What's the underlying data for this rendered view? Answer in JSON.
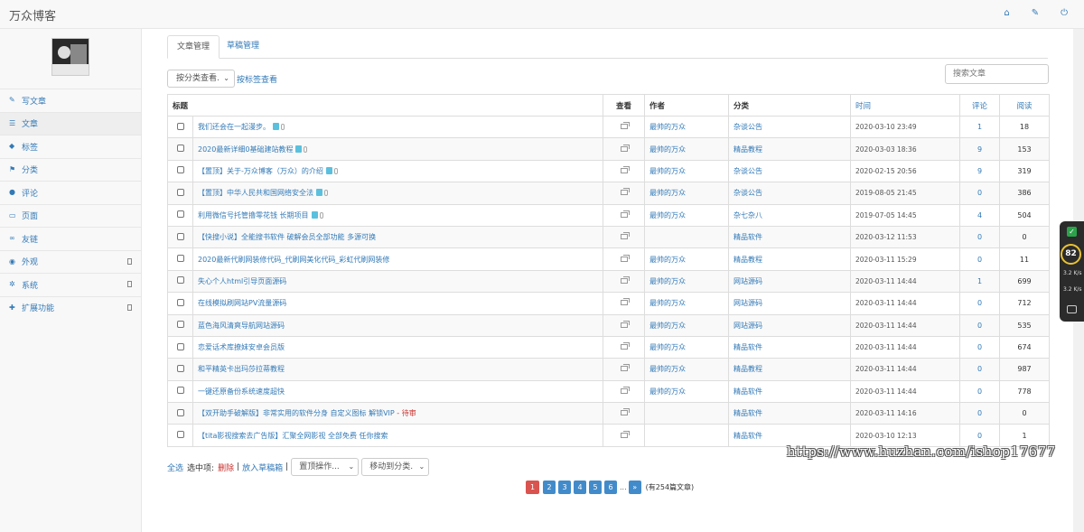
{
  "app": {
    "title": "万众博客"
  },
  "top_icons": [
    "home-icon",
    "wrench-icon",
    "power-icon"
  ],
  "sidebar": {
    "items": [
      {
        "label": "写文章",
        "icon": "pencil-icon",
        "active": false,
        "sub": false
      },
      {
        "label": "文章",
        "icon": "list-icon",
        "active": true,
        "sub": false
      },
      {
        "label": "标签",
        "icon": "tag-icon",
        "active": false,
        "sub": false
      },
      {
        "label": "分类",
        "icon": "flag-icon",
        "active": false,
        "sub": false
      },
      {
        "label": "评论",
        "icon": "comments-icon",
        "active": false,
        "sub": false
      },
      {
        "label": "页面",
        "icon": "file-icon",
        "active": false,
        "sub": false
      },
      {
        "label": "友链",
        "icon": "link-icon",
        "active": false,
        "sub": false
      },
      {
        "label": "外观",
        "icon": "eye-icon",
        "active": false,
        "sub": true
      },
      {
        "label": "系统",
        "icon": "gear-icon",
        "active": false,
        "sub": true
      },
      {
        "label": "扩展功能",
        "icon": "puzzle-icon",
        "active": false,
        "sub": true
      }
    ]
  },
  "tabs": [
    {
      "label": "文章管理",
      "active": true
    },
    {
      "label": "草稿管理",
      "active": false
    }
  ],
  "filters": {
    "category_select": "按分类查看.",
    "tag_link": "按标签查看",
    "search_placeholder": "搜索文章"
  },
  "table": {
    "headers": {
      "title": "标题",
      "view": "查看",
      "author": "作者",
      "category": "分类",
      "time": "时间",
      "comments": "评论",
      "reads": "阅读"
    },
    "rows": [
      {
        "title": "我们还会在一起漫步。",
        "pinned": true,
        "pending": "",
        "author": "最帅的万众",
        "category": "杂谈公告",
        "time": "2020-03-10 23:49",
        "comments": "1",
        "reads": "18"
      },
      {
        "title": "2020最新详细0基础建站教程",
        "pinned": true,
        "pending": "",
        "author": "最帅的万众",
        "category": "精品教程",
        "time": "2020-03-03 18:36",
        "comments": "9",
        "reads": "153"
      },
      {
        "title": "【置顶】关于-万众博客（万众）的介绍",
        "pinned": true,
        "pending": "",
        "author": "最帅的万众",
        "category": "杂谈公告",
        "time": "2020-02-15 20:56",
        "comments": "9",
        "reads": "319"
      },
      {
        "title": "【置顶】中华人民共和国网络安全法",
        "pinned": true,
        "pending": "",
        "author": "最帅的万众",
        "category": "杂谈公告",
        "time": "2019-08-05 21:45",
        "comments": "0",
        "reads": "386"
      },
      {
        "title": "利用微信号托管撸零花钱 长期项目",
        "pinned": true,
        "pending": "",
        "author": "最帅的万众",
        "category": "杂七杂八",
        "time": "2019-07-05 14:45",
        "comments": "4",
        "reads": "504"
      },
      {
        "title": "【快搜小说】全能搜书软件 破解会员全部功能 多源可换",
        "pinned": false,
        "pending": "",
        "author": "",
        "category": "精品软件",
        "time": "2020-03-12 11:53",
        "comments": "0",
        "reads": "0"
      },
      {
        "title": "2020最新代刷网装修代码_代刷网美化代码_彩虹代刷网装修",
        "pinned": false,
        "pending": "",
        "author": "最帅的万众",
        "category": "精品教程",
        "time": "2020-03-11 15:29",
        "comments": "0",
        "reads": "11"
      },
      {
        "title": "失心个人html引导页面源码",
        "pinned": false,
        "pending": "",
        "author": "最帅的万众",
        "category": "网站源码",
        "time": "2020-03-11 14:44",
        "comments": "1",
        "reads": "699"
      },
      {
        "title": "在线模拟刷网站PV流量源码",
        "pinned": false,
        "pending": "",
        "author": "最帅的万众",
        "category": "网站源码",
        "time": "2020-03-11 14:44",
        "comments": "0",
        "reads": "712"
      },
      {
        "title": "蓝色海风清爽导航网站源码",
        "pinned": false,
        "pending": "",
        "author": "最帅的万众",
        "category": "网站源码",
        "time": "2020-03-11 14:44",
        "comments": "0",
        "reads": "535"
      },
      {
        "title": "恋爱话术库撩妹安卓会员版",
        "pinned": false,
        "pending": "",
        "author": "最帅的万众",
        "category": "精品软件",
        "time": "2020-03-11 14:44",
        "comments": "0",
        "reads": "674"
      },
      {
        "title": "和平精英卡出玛莎拉蒂教程",
        "pinned": false,
        "pending": "",
        "author": "最帅的万众",
        "category": "精品教程",
        "time": "2020-03-11 14:44",
        "comments": "0",
        "reads": "987"
      },
      {
        "title": "一键还原备份系统速度超快",
        "pinned": false,
        "pending": "",
        "author": "最帅的万众",
        "category": "精品软件",
        "time": "2020-03-11 14:44",
        "comments": "0",
        "reads": "778"
      },
      {
        "title": "【双开助手破解版】非常实用的软件分身 自定义图标 解锁VIP",
        "pinned": false,
        "pending": "- 待审",
        "author": "",
        "category": "精品软件",
        "time": "2020-03-11 14:16",
        "comments": "0",
        "reads": "0"
      },
      {
        "title": "【tita影视搜索去广告版】汇聚全网影视 全部免费 任你搜索",
        "pinned": false,
        "pending": "",
        "author": "",
        "category": "精品软件",
        "time": "2020-03-10 12:13",
        "comments": "0",
        "reads": "1"
      }
    ]
  },
  "bulk": {
    "select_all": "全选",
    "selected_label": "选中项:",
    "delete": "删除",
    "sep1": "|",
    "to_draft": "放入草稿箱",
    "sep2": "|",
    "pin_select": "置顶操作...",
    "move_select": "移动到分类."
  },
  "pagination": {
    "pages": [
      "1",
      "2",
      "3",
      "4",
      "5",
      "6"
    ],
    "current": "1",
    "ellipsis": "...",
    "next": "»",
    "total": "(有254篇文章)"
  },
  "watermark": "https://www.huzhan.com/ishop17677",
  "widget": {
    "score": "82",
    "up": "3.2 K/s",
    "down": "3.2 K/s"
  },
  "colors": {
    "link": "#337ab7",
    "danger": "#d9534f",
    "primary": "#428bca"
  }
}
